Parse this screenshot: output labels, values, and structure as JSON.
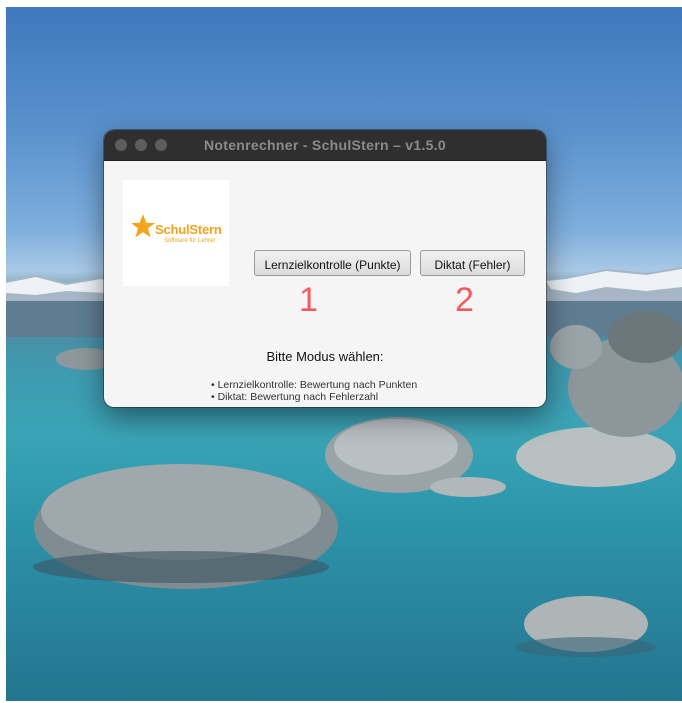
{
  "window": {
    "title": "Notenrechner - SchulStern  –  v1.5.0"
  },
  "logo": {
    "name": "SchulStern",
    "tagline": "Software für Lehrer",
    "color": "#f2a41c"
  },
  "buttons": {
    "points_label": "Lernzielkontrolle (Punkte)",
    "dictation_label": "Diktat (Fehler)"
  },
  "annotations": {
    "first": "1",
    "second": "2",
    "color": "#f4595d"
  },
  "prompt": "Bitte Modus wählen:",
  "info": {
    "line1": "• Lernzielkontrolle: Bewertung nach Punkten",
    "line2": "• Diktat: Bewertung nach Fehlerzahl"
  }
}
